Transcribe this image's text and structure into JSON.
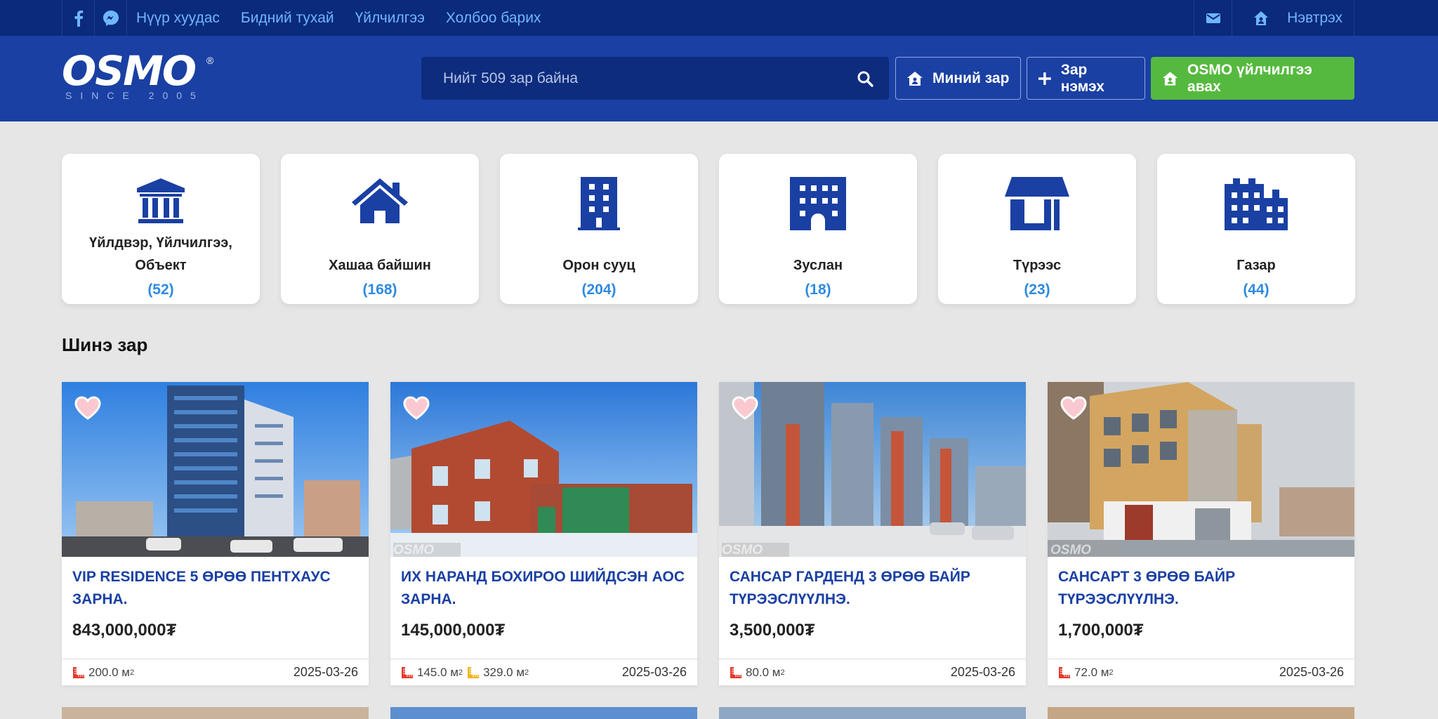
{
  "topnav": {
    "links": [
      "Нүүр хуудас",
      "Бидний тухай",
      "Үйлчилгээ",
      "Холбоо барих"
    ],
    "login_label": "Нэвтрэх"
  },
  "brand": {
    "logo": "OSMO",
    "tagline": "SINCE 2005"
  },
  "search": {
    "placeholder": "Нийт 509 зар байна"
  },
  "header_buttons": {
    "my_ads": "Миний зар",
    "add_ad": "Зар нэмэх",
    "osmo_service": "OSMO үйлчилгээ авах"
  },
  "categories": [
    {
      "name": "Үйлдвэр, Үйлчилгээ, Объект",
      "count": "(52)",
      "icon": "industry-icon"
    },
    {
      "name": "Хашаа байшин",
      "count": "(168)",
      "icon": "house-icon"
    },
    {
      "name": "Орон сууц",
      "count": "(204)",
      "icon": "apartment-icon"
    },
    {
      "name": "Зуслан",
      "count": "(18)",
      "icon": "cottage-icon"
    },
    {
      "name": "Түрээс",
      "count": "(23)",
      "icon": "rent-icon"
    },
    {
      "name": "Газар",
      "count": "(44)",
      "icon": "land-icon"
    }
  ],
  "section": {
    "new_listings": "Шинэ зар"
  },
  "listings": [
    {
      "title": "VIP RESIDENCE 5 ӨРӨӨ ПЕНТХАУС ЗАРНА.",
      "price": "843,000,000₮",
      "area": "200.0 м",
      "land_area": "",
      "date": "2025-03-26"
    },
    {
      "title": "ИХ НАРАНД БОХИРОО ШИЙДСЭН АОС ЗАРНА.",
      "price": "145,000,000₮",
      "area": "145.0 м",
      "land_area": "329.0 м",
      "date": "2025-03-26"
    },
    {
      "title": "САНСАР ГАРДЕНД 3 ӨРӨӨ БАЙР ТҮРЭЭСЛҮҮЛНЭ.",
      "price": "3,500,000₮",
      "area": "80.0 м",
      "land_area": "",
      "date": "2025-03-26"
    },
    {
      "title": "САНСАРТ 3 ӨРӨӨ БАЙР ТҮРЭЭСЛҮҮЛНЭ.",
      "price": "1,700,000₮",
      "area": "72.0 м",
      "land_area": "",
      "date": "2025-03-26"
    }
  ],
  "sup": "2",
  "colors": {
    "topbar": "#0a2a7c",
    "header": "#1a40a3",
    "accent_green": "#56b93f",
    "link_blue": "#2f8ae0"
  }
}
